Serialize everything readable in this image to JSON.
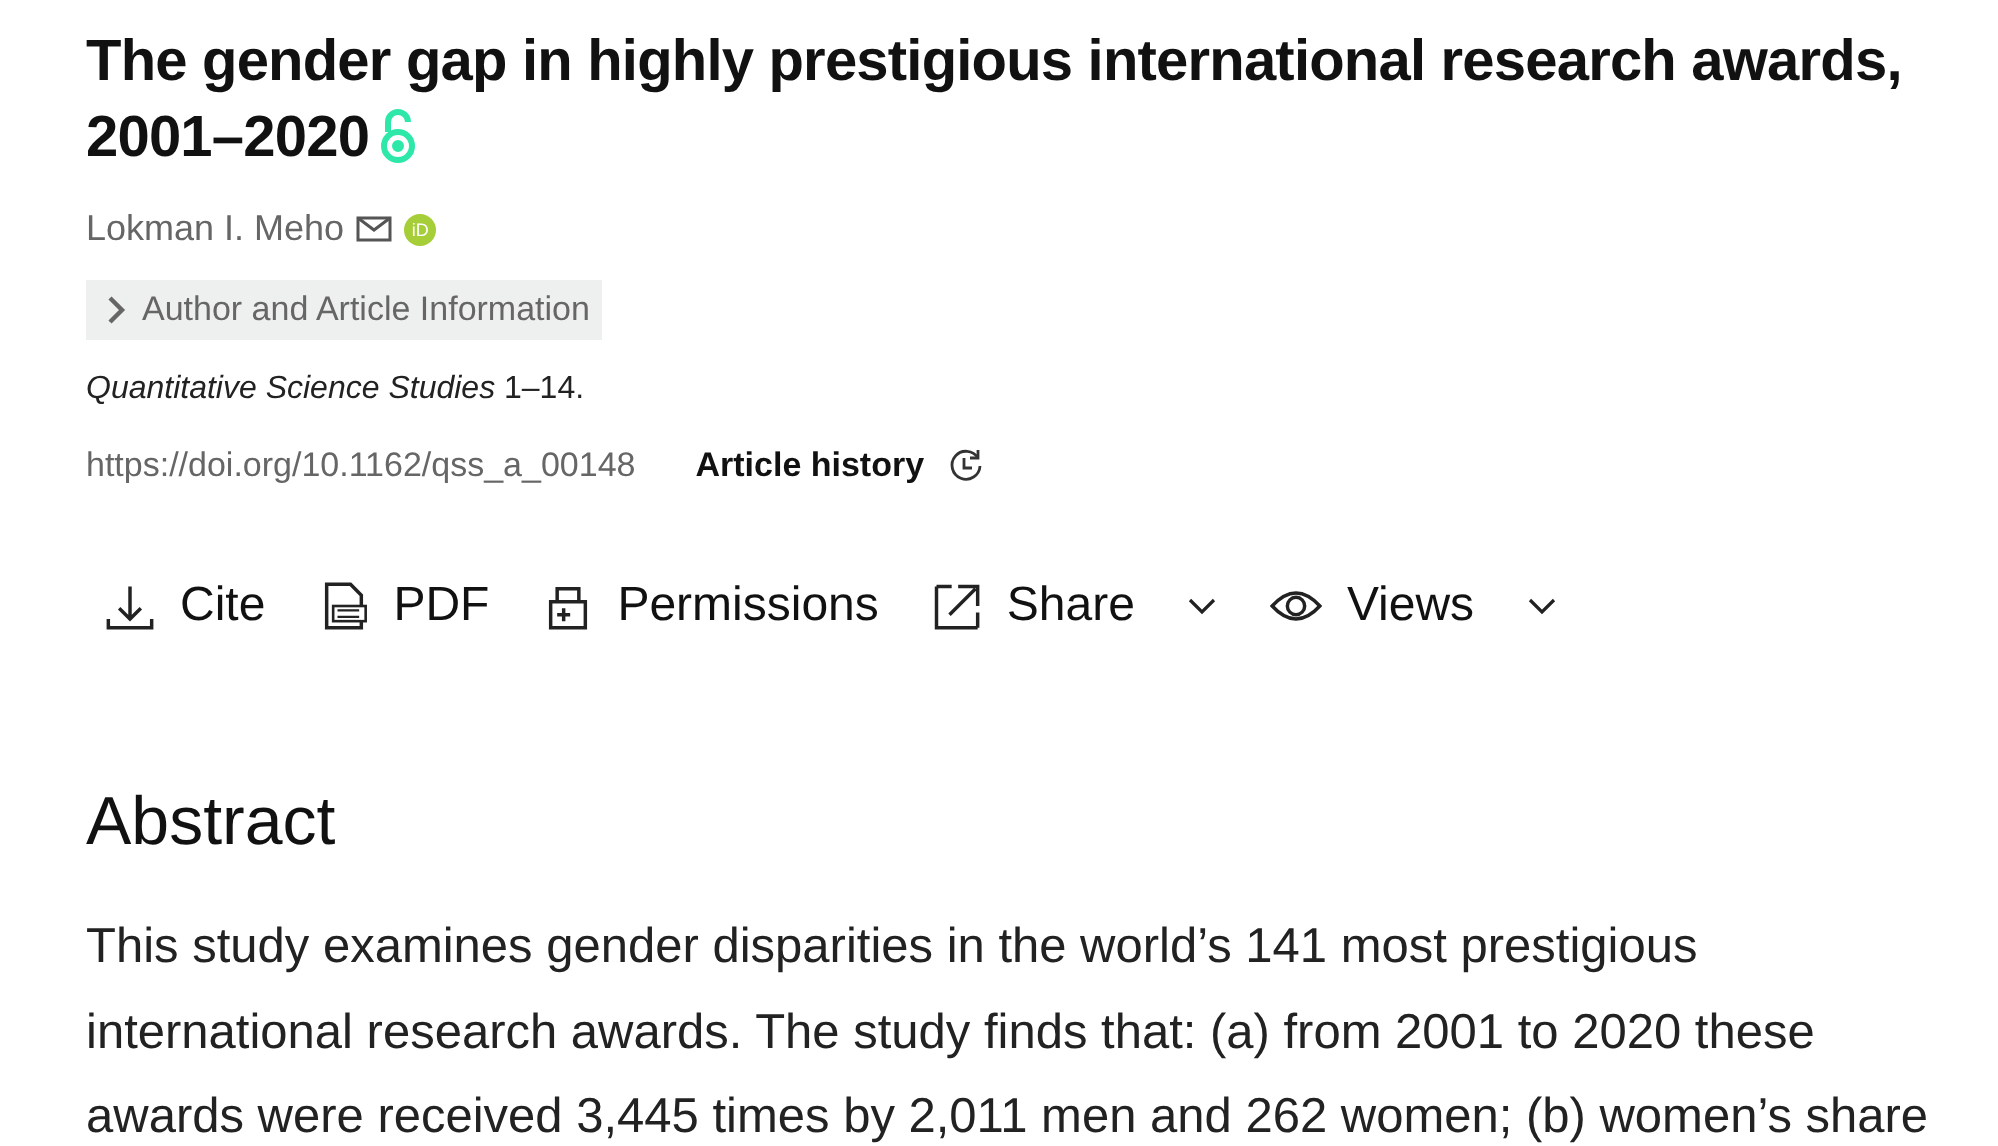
{
  "title": "The gender gap in highly prestigious international research awards, 2001–2020",
  "author": {
    "name": "Lokman I. Meho",
    "orcid": "iD"
  },
  "info_toggle": {
    "label": "Author and Article Information",
    "expanded": false
  },
  "citation": "*Quantitative Science Studies* 1–14.",
  "doi": "https://doi.org/10.1162/qss_a_00148",
  "article_history": "Article history",
  "toolbar": [
    {
      "kind": "cite",
      "label": "Cite",
      "dropdown": false
    },
    {
      "kind": "pdf",
      "label": "PDF",
      "dropdown": false
    },
    {
      "kind": "permissions",
      "label": "Permissions",
      "dropdown": false
    },
    {
      "kind": "share",
      "label": "Share",
      "dropdown": true
    },
    {
      "kind": "views",
      "label": "Views",
      "dropdown": true
    }
  ],
  "abstract": {
    "heading": "Abstract",
    "lines": [
      "This study examines gender disparities in the world’s 141 most prestigious",
      "international research awards. The study finds that: (a) from 2001 to 2020 these",
      "awards were received 3,445 times by 2,011 men and 262 women; (b) women’s share"
    ]
  }
}
